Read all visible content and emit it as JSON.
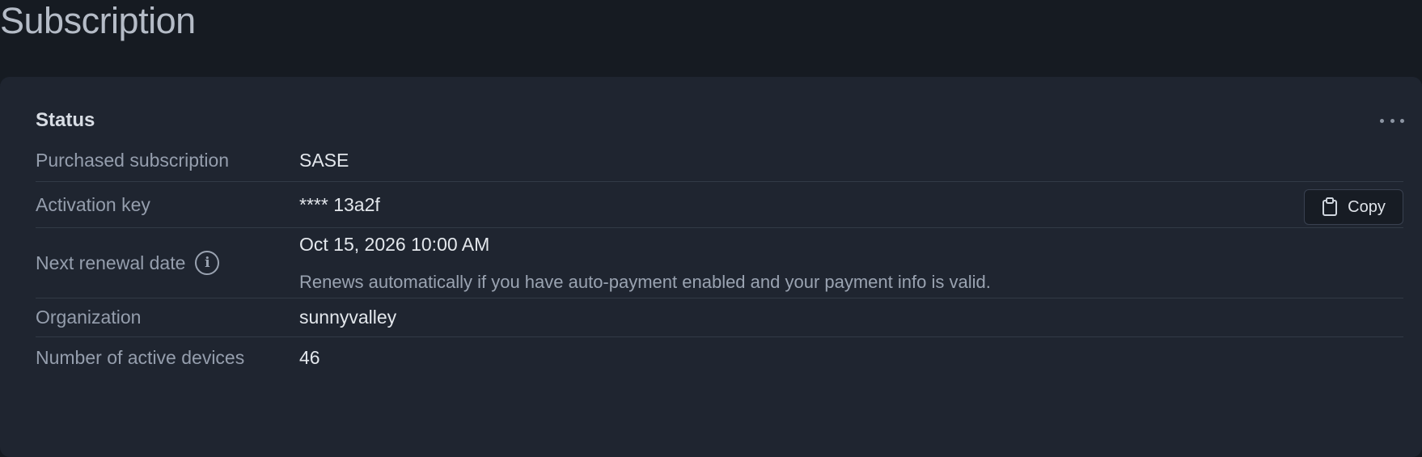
{
  "page": {
    "title": "Subscription"
  },
  "card": {
    "title": "Status",
    "rows": {
      "purchased_subscription": {
        "label": "Purchased subscription",
        "value": "SASE"
      },
      "activation_key": {
        "label": "Activation key",
        "value": "**** 13a2f",
        "copy_label": "Copy"
      },
      "next_renewal_date": {
        "label": "Next renewal date",
        "value": "Oct 15, 2026 10:00 AM",
        "note": "Renews automatically if you have auto-payment enabled and your payment info is valid."
      },
      "organization": {
        "label": "Organization",
        "value": "sunnyvalley"
      },
      "active_devices": {
        "label": "Number of active devices",
        "value": "46"
      }
    }
  },
  "icons": {
    "more": "more-horizontal-icon",
    "info": "info-icon",
    "copy": "clipboard-icon"
  },
  "colors": {
    "background": "#161b22",
    "card": "#1f2530",
    "divider": "#323a46"
  }
}
